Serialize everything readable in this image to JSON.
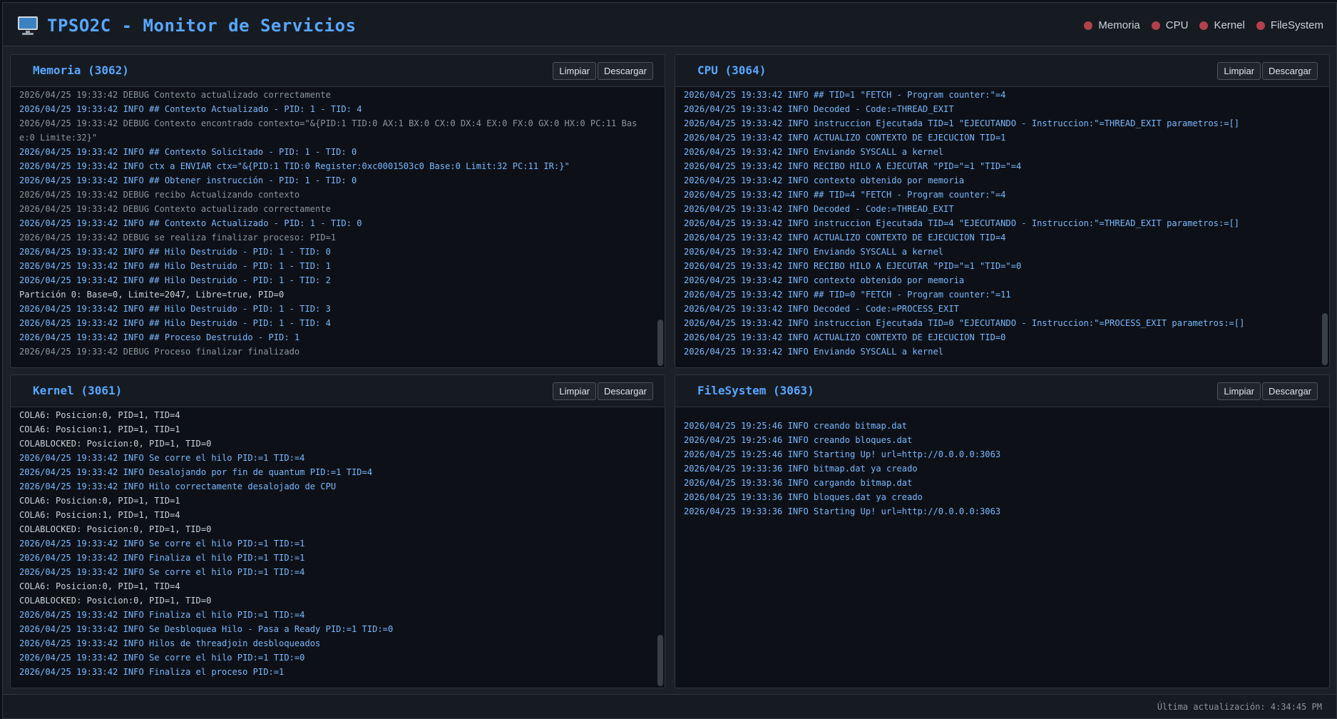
{
  "header": {
    "title": "TPSO2C - Monitor de Servicios",
    "legend": [
      "Memoria",
      "CPU",
      "Kernel",
      "FileSystem"
    ],
    "legend_dot_color": "#b3404a"
  },
  "buttons": {
    "clear": "Limpiar",
    "download": "Descargar"
  },
  "panels": {
    "memoria": {
      "title": "Memoria (3062)",
      "lines": [
        {
          "t": "2026/04/25 19:33:42 DEBUG Contexto actualizado correctamente",
          "k": "debug"
        },
        {
          "t": "2026/04/25 19:33:42 INFO ## Contexto Actualizado - PID: 1 - TID: 4",
          "k": "info"
        },
        {
          "t": "2026/04/25 19:33:42 DEBUG Contexto encontrado contexto=\"&{PID:1 TID:0 AX:1 BX:0 CX:0 DX:4 EX:0 FX:0 GX:0 HX:0 PC:11 Base:0 Limite:32}\"",
          "k": "debug"
        },
        {
          "t": "2026/04/25 19:33:42 INFO ## Contexto Solicitado - PID: 1 - TID: 0",
          "k": "info"
        },
        {
          "t": "2026/04/25 19:33:42 INFO ctx a ENVIAR ctx=\"&{PID:1 TID:0 Register:0xc0001503c0 Base:0 Limit:32 PC:11 IR:}\"",
          "k": "info"
        },
        {
          "t": "2026/04/25 19:33:42 INFO ## Obtener instrucción - PID: 1 - TID: 0",
          "k": "info"
        },
        {
          "t": "2026/04/25 19:33:42 DEBUG recibo Actualizando contexto",
          "k": "debug"
        },
        {
          "t": "2026/04/25 19:33:42 DEBUG Contexto actualizado correctamente",
          "k": "debug"
        },
        {
          "t": "2026/04/25 19:33:42 INFO ## Contexto Actualizado - PID: 1 - TID: 0",
          "k": "info"
        },
        {
          "t": "2026/04/25 19:33:42 DEBUG se realiza finalizar proceso: PID=1",
          "k": "debug"
        },
        {
          "t": "2026/04/25 19:33:42 INFO ## Hilo Destruido - PID: 1 - TID: 0",
          "k": "info"
        },
        {
          "t": "2026/04/25 19:33:42 INFO ## Hilo Destruido - PID: 1 - TID: 1",
          "k": "info"
        },
        {
          "t": "2026/04/25 19:33:42 INFO ## Hilo Destruido - PID: 1 - TID: 2",
          "k": "info"
        },
        {
          "t": "Partición 0: Base=0, Limite=2047, Libre=true, PID=0",
          "k": "plain"
        },
        {
          "t": "2026/04/25 19:33:42 INFO ## Hilo Destruido - PID: 1 - TID: 3",
          "k": "info"
        },
        {
          "t": "2026/04/25 19:33:42 INFO ## Hilo Destruido - PID: 1 - TID: 4",
          "k": "info"
        },
        {
          "t": "2026/04/25 19:33:42 INFO ## Proceso Destruido - PID: 1",
          "k": "info"
        },
        {
          "t": "2026/04/25 19:33:42 DEBUG Proceso finalizar finalizado",
          "k": "debug"
        }
      ]
    },
    "cpu": {
      "title": "CPU (3064)",
      "lines": [
        {
          "t": "2026/04/25 19:33:42 INFO ## TID=1 \"FETCH - Program counter:\"=4",
          "k": "info"
        },
        {
          "t": "2026/04/25 19:33:42 INFO Decoded - Code:=THREAD_EXIT",
          "k": "info"
        },
        {
          "t": "2026/04/25 19:33:42 INFO instruccion Ejecutada TID=1 \"EJECUTANDO - Instruccion:\"=THREAD_EXIT parametros:=[]",
          "k": "info"
        },
        {
          "t": "2026/04/25 19:33:42 INFO ACTUALIZO CONTEXTO DE EJECUCION TID=1",
          "k": "info"
        },
        {
          "t": "2026/04/25 19:33:42 INFO Enviando SYSCALL a kernel",
          "k": "info"
        },
        {
          "t": "2026/04/25 19:33:42 INFO RECIBO HILO A EJECUTAR \"PID=\"=1 \"TID=\"=4",
          "k": "info"
        },
        {
          "t": "2026/04/25 19:33:42 INFO contexto obtenido por memoria",
          "k": "info"
        },
        {
          "t": "2026/04/25 19:33:42 INFO ## TID=4 \"FETCH - Program counter:\"=4",
          "k": "info"
        },
        {
          "t": "2026/04/25 19:33:42 INFO Decoded - Code:=THREAD_EXIT",
          "k": "info"
        },
        {
          "t": "2026/04/25 19:33:42 INFO instruccion Ejecutada TID=4 \"EJECUTANDO - Instruccion:\"=THREAD_EXIT parametros:=[]",
          "k": "info"
        },
        {
          "t": "2026/04/25 19:33:42 INFO ACTUALIZO CONTEXTO DE EJECUCION TID=4",
          "k": "info"
        },
        {
          "t": "2026/04/25 19:33:42 INFO Enviando SYSCALL a kernel",
          "k": "info"
        },
        {
          "t": "2026/04/25 19:33:42 INFO RECIBO HILO A EJECUTAR \"PID=\"=1 \"TID=\"=0",
          "k": "info"
        },
        {
          "t": "2026/04/25 19:33:42 INFO contexto obtenido por memoria",
          "k": "info"
        },
        {
          "t": "2026/04/25 19:33:42 INFO ## TID=0 \"FETCH - Program counter:\"=11",
          "k": "info"
        },
        {
          "t": "2026/04/25 19:33:42 INFO Decoded - Code:=PROCESS_EXIT",
          "k": "info"
        },
        {
          "t": "2026/04/25 19:33:42 INFO instruccion Ejecutada TID=0 \"EJECUTANDO - Instruccion:\"=PROCESS_EXIT parametros:=[]",
          "k": "info"
        },
        {
          "t": "2026/04/25 19:33:42 INFO ACTUALIZO CONTEXTO DE EJECUCION TID=0",
          "k": "info"
        },
        {
          "t": "2026/04/25 19:33:42 INFO Enviando SYSCALL a kernel",
          "k": "info"
        }
      ]
    },
    "kernel": {
      "title": "Kernel (3061)",
      "lines": [
        {
          "t": "COLA6: Posicion:0, PID=1, TID=4",
          "k": "plain"
        },
        {
          "t": "COLA6: Posicion:1, PID=1, TID=1",
          "k": "plain"
        },
        {
          "t": "COLABLOCKED: Posicion:0, PID=1, TID=0",
          "k": "plain"
        },
        {
          "t": "2026/04/25 19:33:42 INFO Se corre el hilo PID:=1 TID:=4",
          "k": "info"
        },
        {
          "t": "2026/04/25 19:33:42 INFO Desalojando por fin de quantum PID:=1 TID=4",
          "k": "info"
        },
        {
          "t": "2026/04/25 19:33:42 INFO Hilo correctamente desalojado de CPU",
          "k": "info"
        },
        {
          "t": "COLA6: Posicion:0, PID=1, TID=1",
          "k": "plain"
        },
        {
          "t": "COLA6: Posicion:1, PID=1, TID=4",
          "k": "plain"
        },
        {
          "t": "COLABLOCKED: Posicion:0, PID=1, TID=0",
          "k": "plain"
        },
        {
          "t": "2026/04/25 19:33:42 INFO Se corre el hilo PID:=1 TID:=1",
          "k": "info"
        },
        {
          "t": "2026/04/25 19:33:42 INFO Finaliza el hilo PID:=1 TID:=1",
          "k": "info"
        },
        {
          "t": "2026/04/25 19:33:42 INFO Se corre el hilo PID:=1 TID:=4",
          "k": "info"
        },
        {
          "t": "COLA6: Posicion:0, PID=1, TID=4",
          "k": "plain"
        },
        {
          "t": "COLABLOCKED: Posicion:0, PID=1, TID=0",
          "k": "plain"
        },
        {
          "t": "2026/04/25 19:33:42 INFO Finaliza el hilo PID:=1 TID:=4",
          "k": "info"
        },
        {
          "t": "2026/04/25 19:33:42 INFO Se Desbloquea Hilo - Pasa a Ready PID:=1 TID:=0",
          "k": "info"
        },
        {
          "t": "2026/04/25 19:33:42 INFO Hilos de threadjoin desbloqueados",
          "k": "info"
        },
        {
          "t": "2026/04/25 19:33:42 INFO Se corre el hilo PID:=1 TID:=0",
          "k": "info"
        },
        {
          "t": "2026/04/25 19:33:42 INFO Finaliza el proceso PID:=1",
          "k": "info"
        }
      ]
    },
    "filesystem": {
      "title": "FileSystem (3063)",
      "lines": [
        {
          "t": "2026/04/25 19:25:46 INFO creando bitmap.dat",
          "k": "info"
        },
        {
          "t": "2026/04/25 19:25:46 INFO creando bloques.dat",
          "k": "info"
        },
        {
          "t": "2026/04/25 19:25:46 INFO Starting Up! url=http://0.0.0.0:3063",
          "k": "info"
        },
        {
          "t": "2026/04/25 19:33:36 INFO bitmap.dat ya creado",
          "k": "info"
        },
        {
          "t": "2026/04/25 19:33:36 INFO cargando bitmap.dat",
          "k": "info"
        },
        {
          "t": "2026/04/25 19:33:36 INFO bloques.dat ya creado",
          "k": "info"
        },
        {
          "t": "2026/04/25 19:33:36 INFO Starting Up! url=http://0.0.0.0:3063",
          "k": "info"
        }
      ]
    }
  },
  "footer": {
    "last_update": "Última actualización: 4:34:45 PM"
  }
}
